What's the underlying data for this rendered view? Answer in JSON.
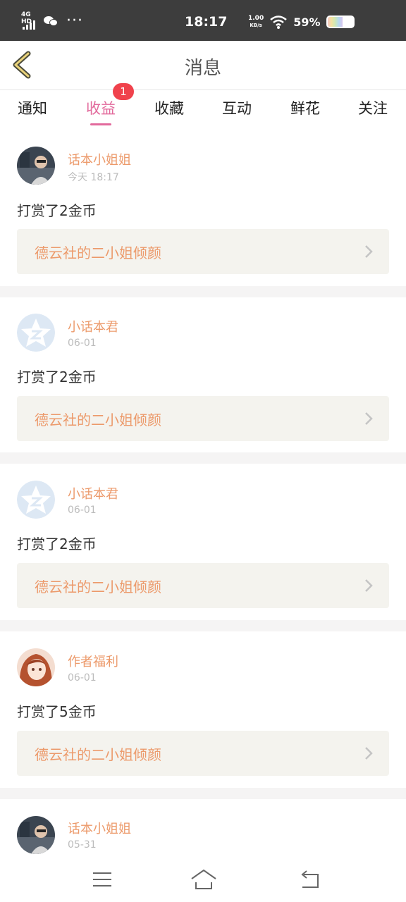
{
  "status_bar": {
    "network": "4G HD",
    "time": "18:17",
    "speed_value": "1.00",
    "speed_unit": "KB/s",
    "battery": "59%",
    "battery_level": 0.59,
    "icons": [
      "signal-icon",
      "wechat-icon",
      "more-dots-icon",
      "wifi-icon",
      "battery-icon"
    ]
  },
  "header": {
    "title": "消息",
    "back_icon": "chevron-left-icon"
  },
  "tabs": [
    {
      "label": "通知",
      "active": false
    },
    {
      "label": "收益",
      "active": true,
      "badge": "1"
    },
    {
      "label": "收藏",
      "active": false
    },
    {
      "label": "互动",
      "active": false
    },
    {
      "label": "鲜花",
      "active": false
    },
    {
      "label": "关注",
      "active": false
    }
  ],
  "messages": [
    {
      "user": "话本小姐姐",
      "time": "今天 18:17",
      "text": "打赏了2金币",
      "book": "德云社的二小姐倾颜",
      "avatar": "photo-avatar"
    },
    {
      "user": "小话本君",
      "time": "06-01",
      "text": "打赏了2金币",
      "book": "德云社的二小姐倾颜",
      "avatar": "default-star-avatar"
    },
    {
      "user": "小话本君",
      "time": "06-01",
      "text": "打赏了2金币",
      "book": "德云社的二小姐倾颜",
      "avatar": "default-star-avatar"
    },
    {
      "user": "作者福利",
      "time": "06-01",
      "text": "打赏了5金币",
      "book": "德云社的二小姐倾颜",
      "avatar": "anime-avatar"
    },
    {
      "user": "话本小姐姐",
      "time": "05-31",
      "text": "",
      "book": "",
      "avatar": "photo-avatar"
    }
  ],
  "nav_bar": {
    "icons": [
      "menu-icon",
      "home-icon",
      "back-icon"
    ]
  },
  "colors": {
    "accent": "#e26a9c",
    "badge": "#f0424c",
    "name": "#ec9a6b",
    "card_bg": "#f4f3ee",
    "status_bar": "#3d3d3d"
  }
}
